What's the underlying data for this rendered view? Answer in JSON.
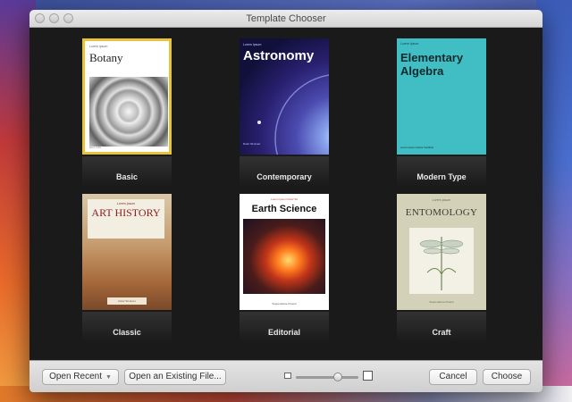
{
  "window": {
    "title": "Template Chooser"
  },
  "templates": [
    {
      "name": "Basic",
      "cover": {
        "small": "Lorem Ipsum",
        "title": "Botany",
        "footer": "Eius nulla"
      }
    },
    {
      "name": "Contemporary",
      "cover": {
        "small": "Lorem Ipsum",
        "title": "Astronomy",
        "footer": "Dolor Sit Amet"
      }
    },
    {
      "name": "Modern Type",
      "cover": {
        "small": "Lorem Ipsum",
        "title": "Elementary Algebra",
        "footer": "Lorem Ipsum Dolor Facilisis"
      }
    },
    {
      "name": "Classic",
      "cover": {
        "small": "Lorem Ipsum",
        "title": "ART HISTORY",
        "footer": "Dolor Sit Amet"
      }
    },
    {
      "name": "Editorial",
      "cover": {
        "small": "Lorem Ipsum Dolor Sit",
        "title": "Earth Science",
        "footer": "Suspendisse Potenti"
      }
    },
    {
      "name": "Craft",
      "cover": {
        "small": "Lorem Ipsum",
        "title": "ENTOMOLOGY",
        "footer": "Suspendisse Potenti"
      }
    }
  ],
  "toolbar": {
    "open_recent": "Open Recent",
    "open_existing": "Open an Existing File...",
    "cancel": "Cancel",
    "choose": "Choose"
  },
  "colors": {
    "selection": "#e8c33a",
    "content_bg": "#1a1a1a"
  }
}
